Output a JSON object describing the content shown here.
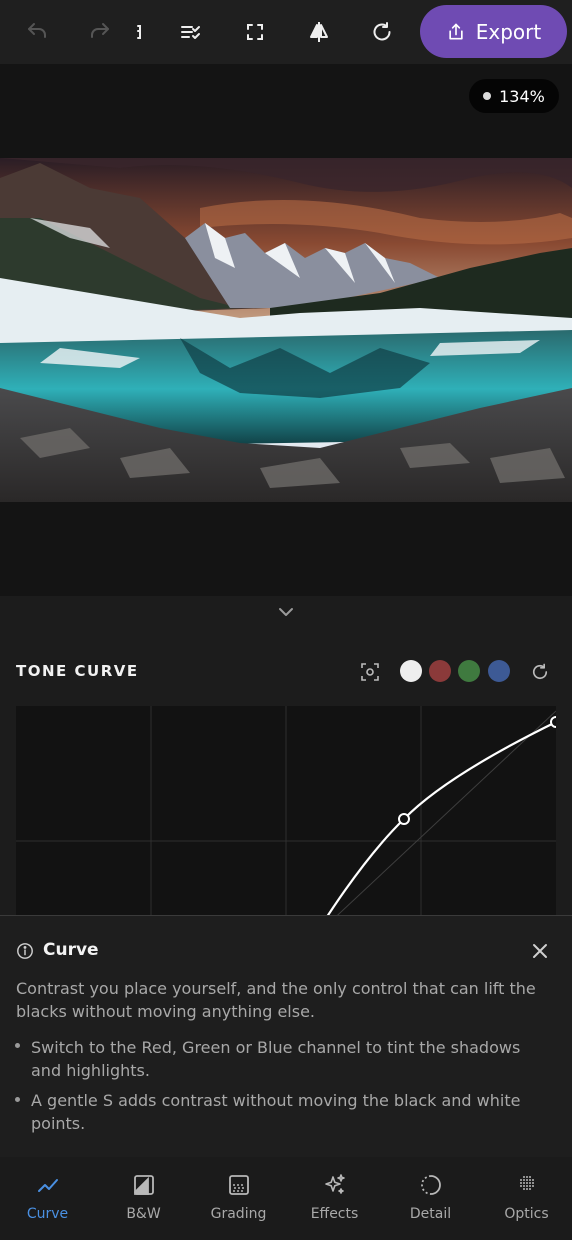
{
  "toolbar": {
    "icons": [
      "undo-icon",
      "redo-icon",
      "panel-icon",
      "checklist-icon",
      "fullscreen-icon",
      "compare-icon",
      "reset-icon"
    ],
    "export_label": "Export",
    "export_icon": "share-icon",
    "accent": "#6f4bb3"
  },
  "preview": {
    "zoom_label": "134%"
  },
  "tone_curve": {
    "title": "TONE CURVE",
    "channels": [
      {
        "name": "RGB",
        "color": "#eeeeee"
      },
      {
        "name": "Red",
        "color": "#8b3a3a"
      },
      {
        "name": "Green",
        "color": "#3f7a3f"
      },
      {
        "name": "Blue",
        "color": "#3d5a95"
      }
    ]
  },
  "info": {
    "title": "Curve",
    "description": "Contrast you place yourself, and the only control that can lift the blacks without moving anything else.",
    "tips": [
      "Switch to the Red, Green or Blue channel to tint the shadows and highlights.",
      "A gentle S adds contrast without moving the black and white points."
    ]
  },
  "nav": {
    "items": [
      {
        "label": "Curve",
        "icon": "curve-icon",
        "active": true
      },
      {
        "label": "B&W",
        "icon": "bw-icon",
        "active": false
      },
      {
        "label": "Grading",
        "icon": "grading-icon",
        "active": false
      },
      {
        "label": "Effects",
        "icon": "sparkle-icon",
        "active": false
      },
      {
        "label": "Detail",
        "icon": "detail-icon",
        "active": false
      },
      {
        "label": "Optics",
        "icon": "optics-icon",
        "active": false
      }
    ],
    "active_color": "#4a90e2"
  }
}
